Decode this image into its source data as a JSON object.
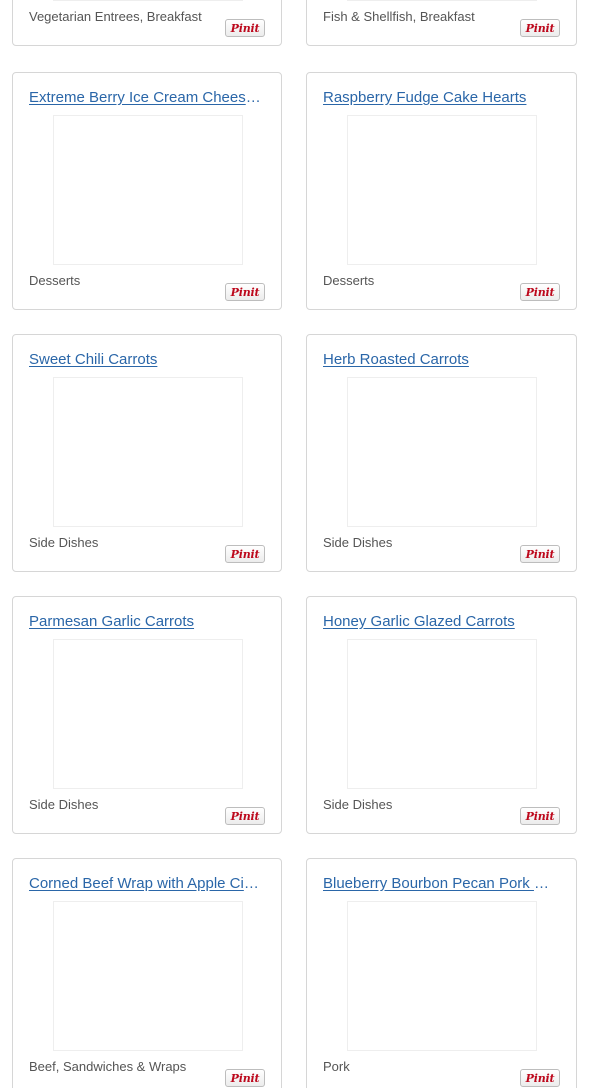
{
  "rows": [
    {
      "cards": [
        {
          "title": "",
          "category": "Vegetarian Entrees, Breakfast",
          "pin_label": "Pinit"
        },
        {
          "title": "",
          "category": "Fish & Shellfish, Breakfast",
          "pin_label": "Pinit"
        }
      ]
    },
    {
      "cards": [
        {
          "title": "Extreme Berry Ice Cream Cheesecake",
          "category": "Desserts",
          "pin_label": "Pinit"
        },
        {
          "title": "Raspberry Fudge Cake Hearts",
          "category": "Desserts",
          "pin_label": "Pinit"
        }
      ]
    },
    {
      "cards": [
        {
          "title": "Sweet Chili Carrots",
          "category": "Side Dishes",
          "pin_label": "Pinit"
        },
        {
          "title": "Herb Roasted Carrots",
          "category": "Side Dishes",
          "pin_label": "Pinit"
        }
      ]
    },
    {
      "cards": [
        {
          "title": "Parmesan Garlic Carrots",
          "category": "Side Dishes",
          "pin_label": "Pinit"
        },
        {
          "title": "Honey Garlic Glazed Carrots",
          "category": "Side Dishes",
          "pin_label": "Pinit"
        }
      ]
    },
    {
      "cards": [
        {
          "title": "Corned Beef Wrap with Apple Cider Slaw",
          "category": "Beef, Sandwiches & Wraps",
          "pin_label": "Pinit"
        },
        {
          "title": "Blueberry Bourbon Pecan Pork Chops",
          "category": "Pork",
          "pin_label": "Pinit"
        }
      ]
    }
  ]
}
